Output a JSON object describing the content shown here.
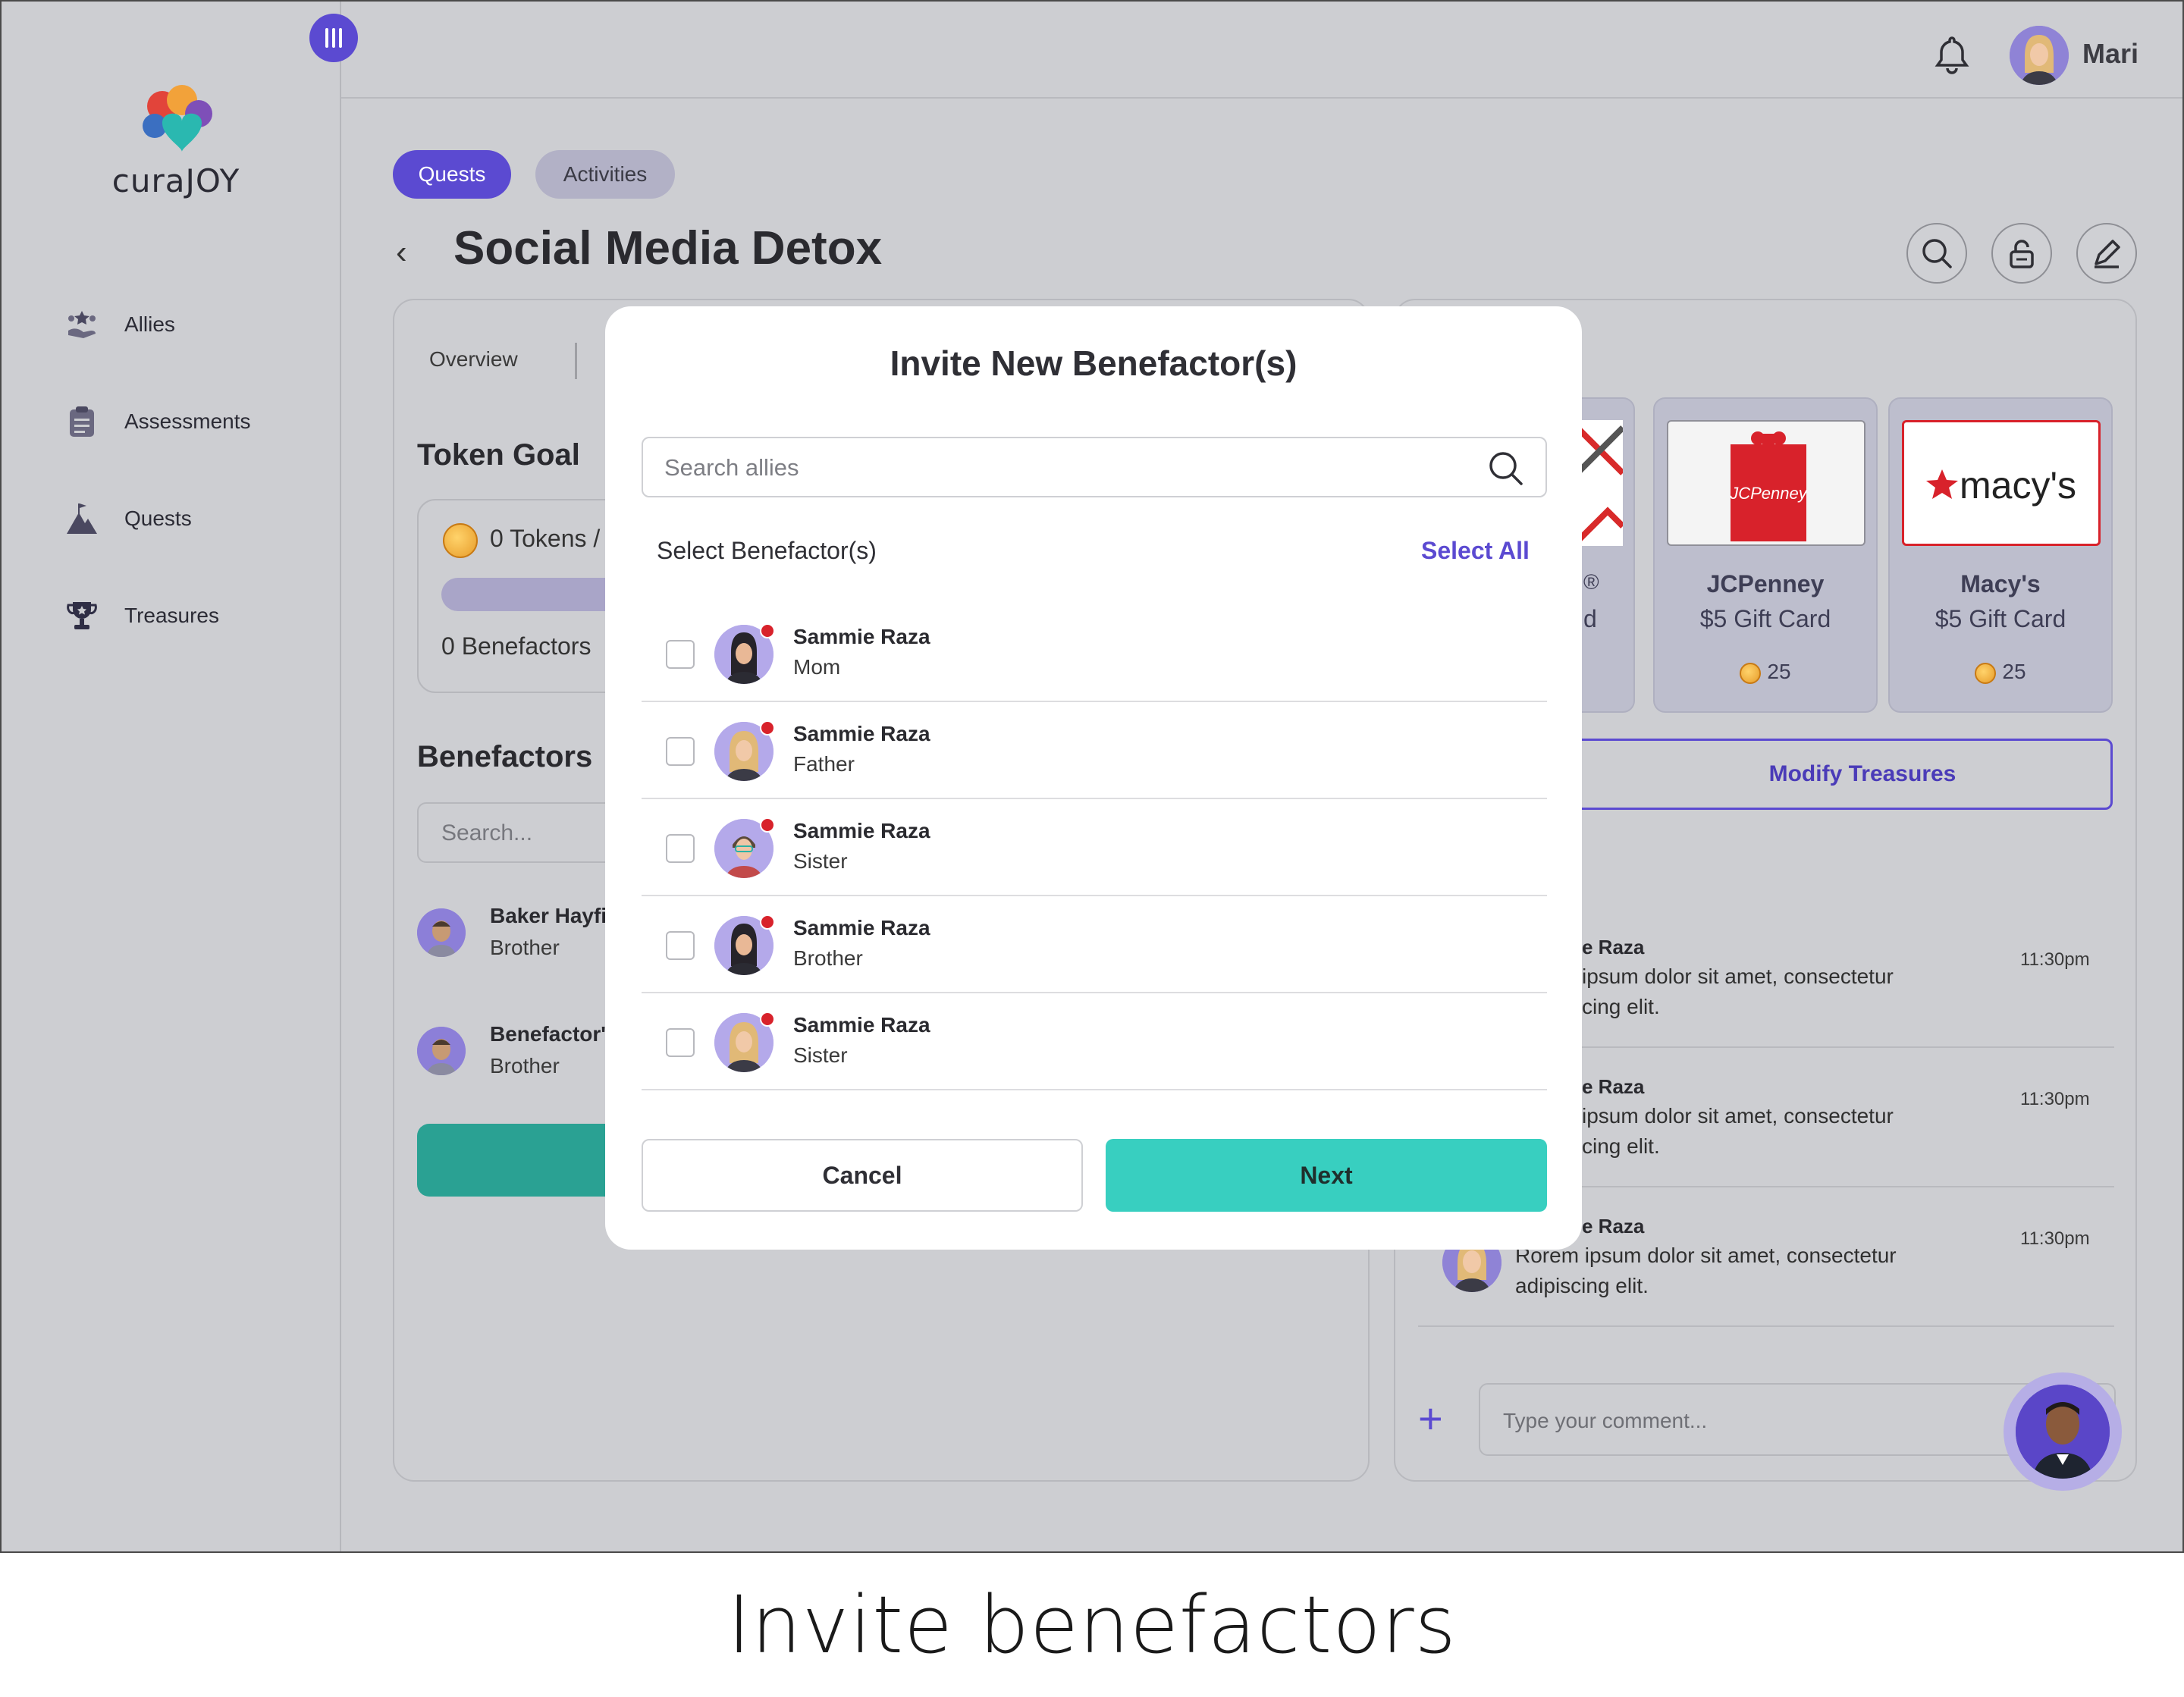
{
  "app": {
    "brand": "curaJOY",
    "caption": "Invite benefactors"
  },
  "sidebar": {
    "items": [
      {
        "label": "Allies",
        "icon": "allies-icon"
      },
      {
        "label": "Assessments",
        "icon": "clipboard-icon"
      },
      {
        "label": "Quests",
        "icon": "mountain-flag-icon"
      },
      {
        "label": "Treasures",
        "icon": "trophy-icon"
      }
    ]
  },
  "header": {
    "user_name": "Mari"
  },
  "tabs": {
    "quests": "Quests",
    "activities": "Activities"
  },
  "page": {
    "title": "Social Media Detox",
    "subtab_overview": "Overview"
  },
  "left_panel": {
    "token_goal_title": "Token Goal",
    "tokens_text": "0 Tokens /",
    "benefactors_count": "0 Benefactors",
    "benefactors_title": "Benefactors",
    "search_placeholder": "Search...",
    "benefactors": [
      {
        "name": "Baker Hayfi",
        "relation": "Brother"
      },
      {
        "name": "Benefactor'",
        "relation": "Brother"
      }
    ]
  },
  "right_panel": {
    "partial_card": {
      "line1": "®",
      "line2": "d"
    },
    "treasures": [
      {
        "name": "JCPenney",
        "subtitle": "$5 Gift Card",
        "cost": "25",
        "logo_text": "JCPenney"
      },
      {
        "name": "Macy's",
        "subtitle": "$5 Gift Card",
        "cost": "25",
        "logo_text": "macy's"
      }
    ],
    "modify_label": "Modify Treasures",
    "comments": [
      {
        "name": "e Raza",
        "line1": "ipsum dolor sit amet, consectetur",
        "line2": "cing elit.",
        "time": "11:30pm"
      },
      {
        "name": "e Raza",
        "line1": "ipsum dolor sit amet, consectetur",
        "line2": "cing elit.",
        "time": "11:30pm"
      },
      {
        "name": "e Raza",
        "line1": "Rorem ipsum dolor sit amet, consectetur",
        "line2": "adipiscing elit.",
        "time": "11:30pm"
      }
    ],
    "comment_placeholder": "Type your comment..."
  },
  "modal": {
    "title": "Invite New Benefactor(s)",
    "search_placeholder": "Search allies",
    "select_label": "Select Benefactor(s)",
    "select_all": "Select All",
    "allies": [
      {
        "name": "Sammie Raza",
        "relation": "Mom",
        "checked": false
      },
      {
        "name": "Sammie Raza",
        "relation": "Father",
        "checked": false
      },
      {
        "name": "Sammie Raza",
        "relation": "Sister",
        "checked": false
      },
      {
        "name": "Sammie Raza",
        "relation": "Brother",
        "checked": false
      },
      {
        "name": "Sammie Raza",
        "relation": "Sister",
        "checked": false
      }
    ],
    "cancel_label": "Cancel",
    "next_label": "Next"
  },
  "colors": {
    "accent": "#5b4ad1",
    "teal": "#38cfc0",
    "notification_dot": "#d8222b",
    "overlay_bg": "#cdced2"
  }
}
